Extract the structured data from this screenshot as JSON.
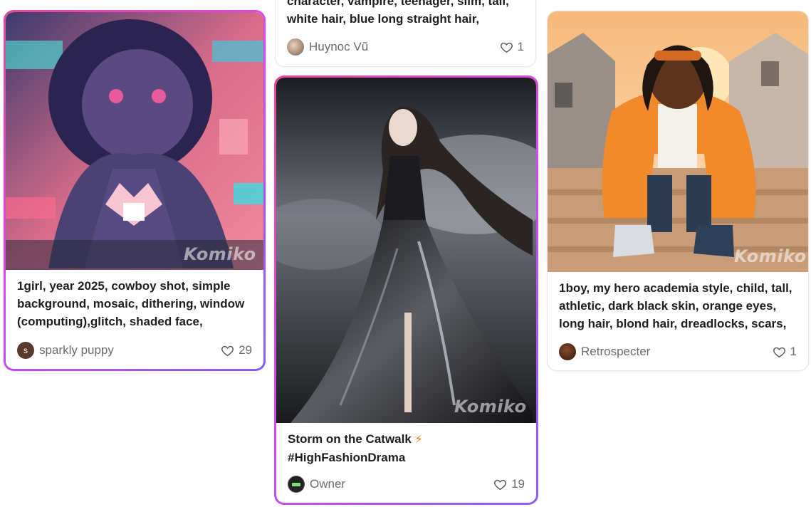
{
  "cards": [
    {
      "caption": "1girl, year 2025, cowboy shot, simple background, mosaic, dithering, window (computing),glitch, shaded face,",
      "author": "sparkly puppy",
      "avatar_letter": "s",
      "likes": "29",
      "watermark": "Komiko",
      "featured": true
    },
    {
      "caption": "character, vampire, teenager, slim, tall, white hair, blue long straight hair,",
      "author": "Huynoc Vũ",
      "likes": "1",
      "featured": false
    },
    {
      "caption_line1": "Storm on the Catwalk",
      "caption_emoji": "⚡",
      "caption_line2": "#HighFashionDrama",
      "author": "Owner",
      "likes": "19",
      "watermark": "Komiko",
      "featured": true
    },
    {
      "caption": "1boy, my hero academia style, child, tall, athletic, dark black skin, orange eyes, long hair, blond hair, dreadlocks, scars,",
      "author": "Retrospecter",
      "likes": "1",
      "watermark": "Komiko",
      "featured": false
    }
  ],
  "colors": {
    "featured_gradient_start": "#ec4899",
    "featured_gradient_end": "#8b5cf6",
    "text": "#1f1f1f",
    "meta_text": "#6b6b6b"
  },
  "icons": {
    "like": "heart-icon",
    "emoji": "lightning-bolt-icon"
  }
}
